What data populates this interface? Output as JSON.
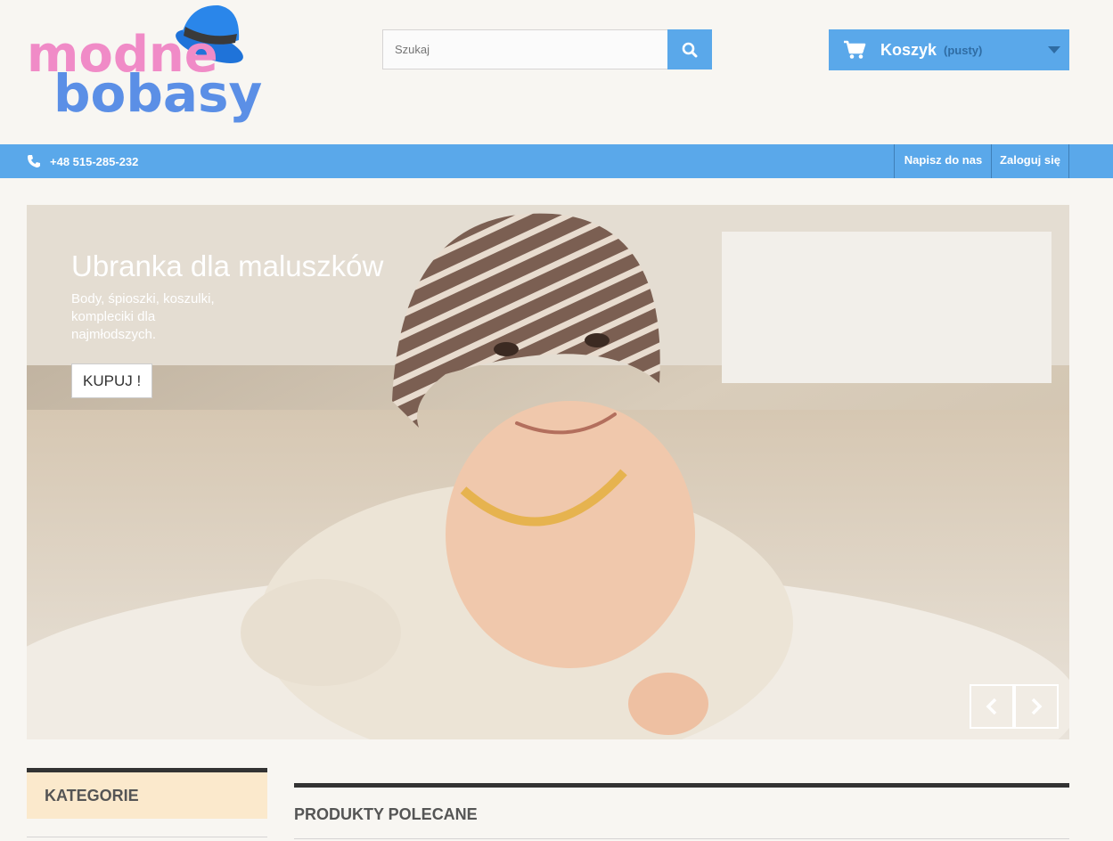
{
  "brand": {
    "logo_word1": "modne",
    "logo_word2": "bobasy",
    "colors": {
      "pink": "#f08bc7",
      "blue": "#5b8fe6",
      "hat": "#1f73d9"
    }
  },
  "search": {
    "placeholder": "Szukaj",
    "button_icon": "search-icon"
  },
  "cart": {
    "label": "Koszyk",
    "status": "(pusty)",
    "icon": "cart-icon"
  },
  "topbar": {
    "phone": "+48 515-285-232",
    "links": [
      "Napisz do nas",
      "Zaloguj się"
    ]
  },
  "slider": {
    "title": "Ubranka dla maluszków",
    "description": "Body, śpioszki, koszulki, kompleciki dla najmłodszych.",
    "button": "KUPUJ !"
  },
  "sections": {
    "categories": "KATEGORIE",
    "featured": "PRODUKTY POLECANE"
  },
  "theme": {
    "accent": "#5aa8ea",
    "page_bg": "#f8f6f2",
    "category_bg": "#fbe9cc"
  }
}
